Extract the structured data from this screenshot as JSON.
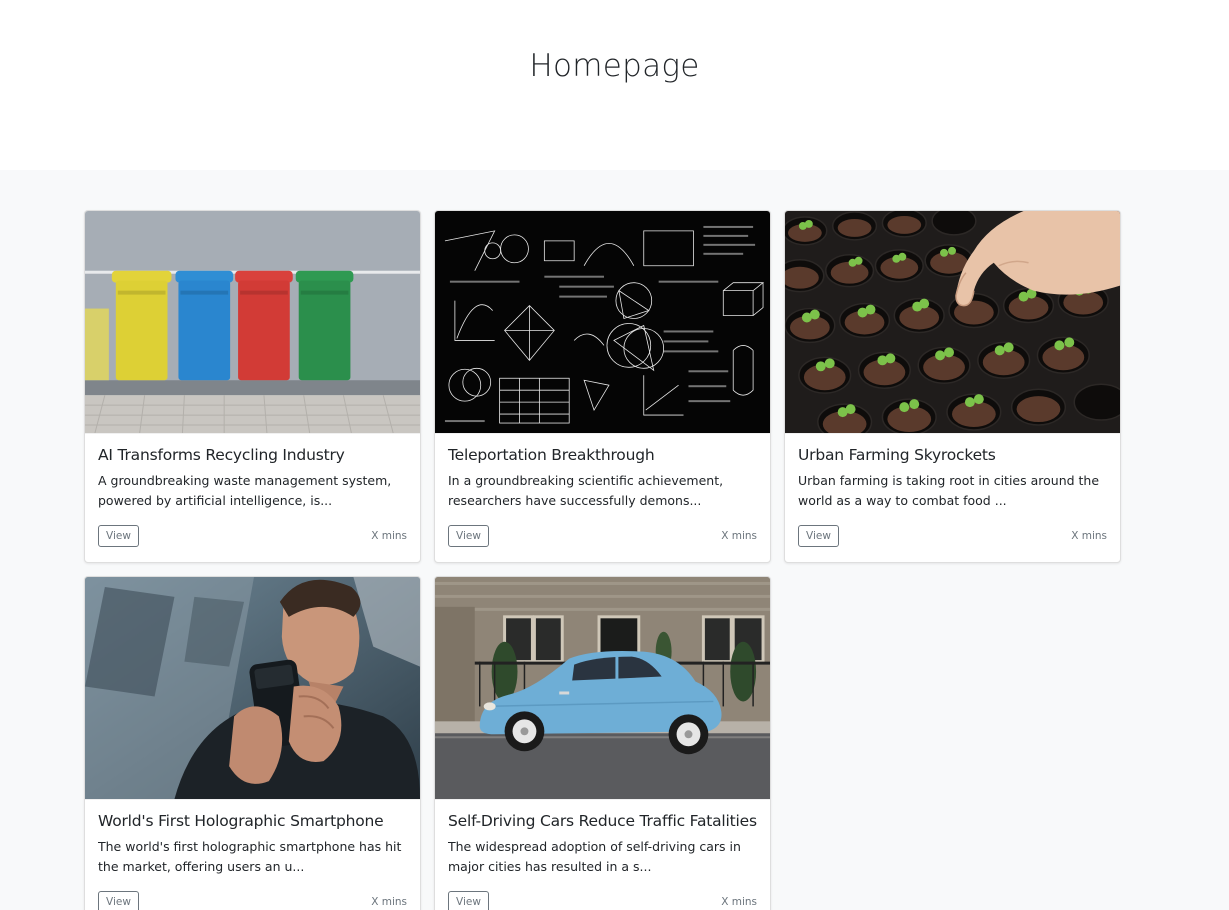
{
  "page": {
    "title": "Homepage"
  },
  "posts": [
    {
      "title": "AI Transforms Recycling Industry",
      "excerpt": "A groundbreaking waste management system, powered by artificial intelligence, is...",
      "button_label": "View",
      "read_time": "X mins"
    },
    {
      "title": "Teleportation Breakthrough",
      "excerpt": "In a groundbreaking scientific achievement, researchers have successfully demons...",
      "button_label": "View",
      "read_time": "X mins"
    },
    {
      "title": "Urban Farming Skyrockets",
      "excerpt": "Urban farming is taking root in cities around the world as a way to combat food ...",
      "button_label": "View",
      "read_time": "X mins"
    },
    {
      "title": "World's First Holographic Smartphone",
      "excerpt": "The world's first holographic smartphone has hit the market, offering users an u...",
      "button_label": "View",
      "read_time": "X mins"
    },
    {
      "title": "Self-Driving Cars Reduce Traffic Fatalities",
      "excerpt": "The widespread adoption of self-driving cars in major cities has resulted in a s...",
      "button_label": "View",
      "read_time": "X mins"
    }
  ],
  "colors": {
    "page_background": "#f8f9fa",
    "hero_background": "#ffffff",
    "muted_text": "#6c757d",
    "body_text": "#212529"
  }
}
